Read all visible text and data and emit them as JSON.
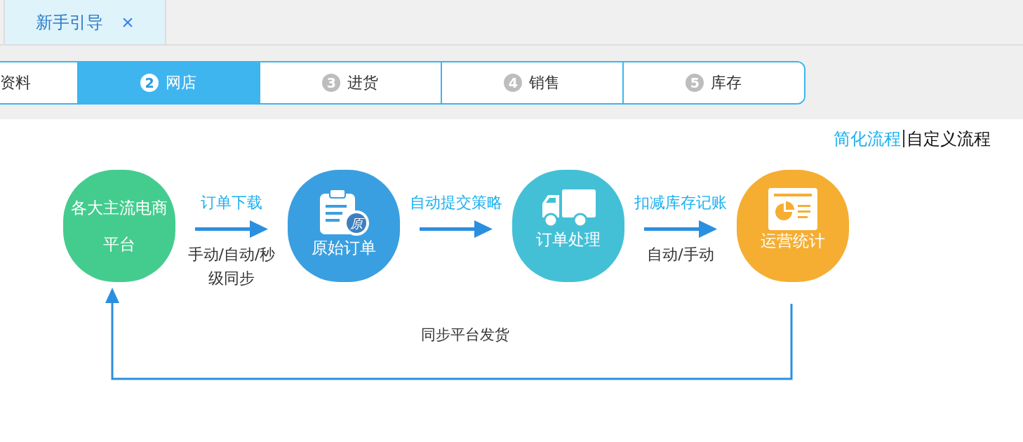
{
  "tabs": [
    {
      "label": "新手引导",
      "close": "×",
      "selected": true
    }
  ],
  "steps": [
    {
      "label": "资料",
      "selected": false
    },
    {
      "number": "2",
      "label": "网店",
      "selected": true
    },
    {
      "number": "3",
      "label": "进货",
      "selected": false
    },
    {
      "number": "4",
      "label": "销售",
      "selected": false
    },
    {
      "number": "5",
      "label": "库存",
      "selected": false
    }
  ],
  "mode_switch": [
    {
      "label": "简化流程",
      "selected": true
    },
    {
      "label": "自定义流程",
      "selected": false
    }
  ],
  "mode_separator": "|",
  "flow": {
    "nodes": [
      {
        "kind": "text",
        "label": "各大主流电商平台",
        "color": "#44cc8e"
      },
      {
        "kind": "icon",
        "label": "原始订单",
        "badge": "原",
        "color": "#3a9fe0"
      },
      {
        "kind": "icon",
        "label": "订单处理",
        "color": "#44c0d6"
      },
      {
        "kind": "icon",
        "label": "运营统计",
        "color": "#f5ae32"
      }
    ],
    "connectors": [
      {
        "label": "订单下载",
        "note": "手动/自动/秒级同步"
      },
      {
        "label": "自动提交策略"
      },
      {
        "label": "扣减库存记账",
        "note": "自动/手动"
      }
    ],
    "return_label": "同步平台发货"
  }
}
